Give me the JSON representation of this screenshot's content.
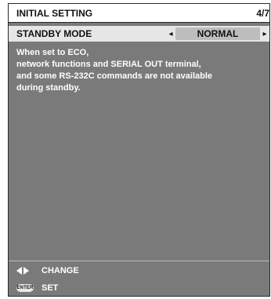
{
  "header": {
    "title": "INITIAL SETTING",
    "page": "4/7"
  },
  "setting": {
    "label": "STANDBY MODE",
    "value": "NORMAL"
  },
  "message": {
    "lines": [
      "When set to ECO,",
      "network functions and SERIAL OUT terminal,",
      "and some RS-232C commands are not available",
      "during standby."
    ]
  },
  "footer": {
    "change_label": "CHANGE",
    "set_label": "SET",
    "enter_icon_text": "ENTER"
  },
  "icons": {
    "left": "triangle-left-icon",
    "right": "triangle-right-icon",
    "enter": "enter-button-icon"
  }
}
